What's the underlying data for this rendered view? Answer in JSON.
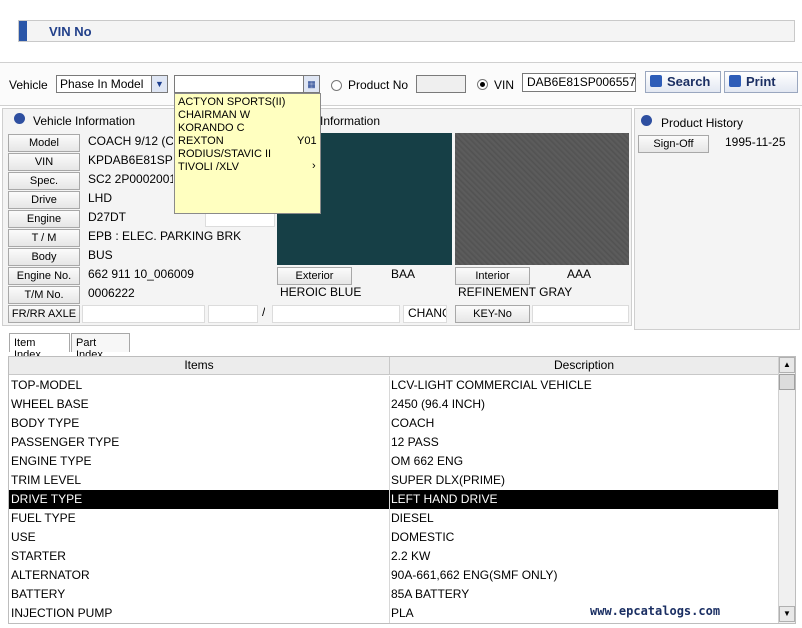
{
  "title": "VIN No",
  "toolbar": {
    "vehicle_label": "Vehicle",
    "vehicle_select": "Phase In Model",
    "model_input": "",
    "product_no_label": "Product No",
    "product_no_value": "",
    "vin_label": "VIN",
    "vin_value": "DAB6E81SP006557",
    "search_label": "Search",
    "print_label": "Print"
  },
  "dropdown": {
    "items": [
      "ACTYON SPORTS(II)",
      "CHAIRMAN W",
      "KORANDO C",
      "REXTON",
      "RODIUS/STAVIC II",
      "TIVOLI /XLV"
    ],
    "rexton_code": "Y01",
    "submenu_arrow": "›"
  },
  "vehicle_info": {
    "title": "Vehicle Information",
    "fields": [
      {
        "label": "Model",
        "value": "COACH 9/12 (C"
      },
      {
        "label": "VIN",
        "value": "KPDAB6E81SP0"
      },
      {
        "label": "Spec.",
        "value": "SC2 2P0002001"
      },
      {
        "label": "Drive",
        "value": "LHD"
      },
      {
        "label": "Engine",
        "value": "D27DT"
      },
      {
        "label": "T / M",
        "value": "EPB : ELEC. PARKING BRK"
      },
      {
        "label": "Body",
        "value": "BUS"
      },
      {
        "label": "Engine No.",
        "value": "662 911 10_006009"
      },
      {
        "label": "T/M No.",
        "value": "0006222"
      },
      {
        "label": "FR/RR AXLE",
        "value": ""
      }
    ],
    "axle_sep": "/",
    "chang_text": "CHANG"
  },
  "color_info": {
    "title": "Information",
    "exterior_label": "Exterior",
    "exterior_code": "BAA",
    "exterior_name": "HEROIC BLUE",
    "interior_label": "Interior",
    "interior_code": "AAA",
    "interior_name": "REFINEMENT GRAY",
    "keyno_label": "KEY-No",
    "exterior_color": "#163f46",
    "interior_color": "#5a5a5a"
  },
  "history": {
    "title": "Product History",
    "signoff_label": "Sign-Off",
    "signoff_date": "1995-11-25"
  },
  "tabs": [
    "Item Index",
    "Part Index"
  ],
  "grid": {
    "headers": [
      "Items",
      "Description"
    ],
    "rows": [
      {
        "item": "TOP-MODEL",
        "desc": "LCV-LIGHT COMMERCIAL VEHICLE"
      },
      {
        "item": "WHEEL BASE",
        "desc": "2450  (96.4 INCH)"
      },
      {
        "item": "BODY TYPE",
        "desc": "COACH"
      },
      {
        "item": "PASSENGER TYPE",
        "desc": "12 PASS"
      },
      {
        "item": "ENGINE TYPE",
        "desc": "OM 662 ENG"
      },
      {
        "item": "TRIM LEVEL",
        "desc": "SUPER DLX(PRIME)"
      },
      {
        "item": "DRIVE TYPE",
        "desc": "LEFT HAND DRIVE"
      },
      {
        "item": "FUEL TYPE",
        "desc": "DIESEL"
      },
      {
        "item": "USE",
        "desc": "DOMESTIC"
      },
      {
        "item": "STARTER",
        "desc": "2.2 KW"
      },
      {
        "item": "ALTERNATOR",
        "desc": "90A-661,662 ENG(SMF ONLY)"
      },
      {
        "item": "BATTERY",
        "desc": "85A BATTERY"
      },
      {
        "item": "INJECTION PUMP",
        "desc": "PLA"
      }
    ],
    "selected_index": 6
  },
  "watermark": "www.epcatalogs.com"
}
